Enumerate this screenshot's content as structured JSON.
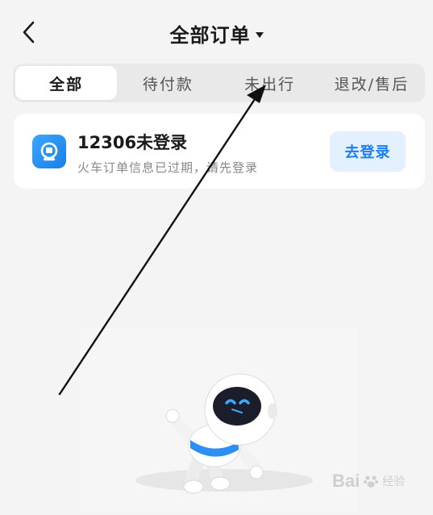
{
  "header": {
    "title": "全部订单"
  },
  "tabs": [
    {
      "label": "全部",
      "active": true
    },
    {
      "label": "待付款",
      "active": false
    },
    {
      "label": "未出行",
      "active": false
    },
    {
      "label": "退改/售后",
      "active": false
    }
  ],
  "login_card": {
    "title": "12306未登录",
    "subtitle": "火车订单信息已过期，请先登录",
    "button_label": "去登录",
    "icon": "railway-12306-icon"
  },
  "watermark": {
    "text": "Bai",
    "suffix": "经验"
  },
  "colors": {
    "accent": "#1b7ff0",
    "accent_bg": "#e3f0ff",
    "background": "#f4f4f4",
    "card": "#ffffff"
  }
}
